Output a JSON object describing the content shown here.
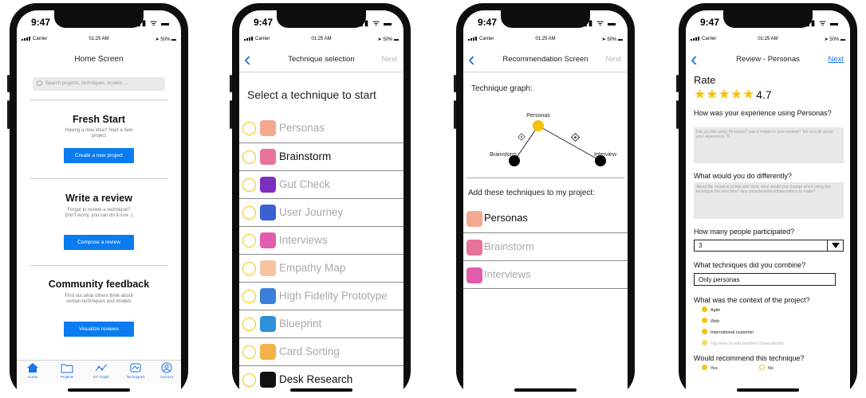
{
  "status_bar": {
    "time": "9:47",
    "carrier": "Carrier",
    "clock": "01:25 AM",
    "battery": "50%"
  },
  "accent_color": "#0a7cf0",
  "highlight_color": "#f4c20d",
  "home": {
    "title": "Home Screen",
    "search_placeholder": "Search projects, techniques, models ...",
    "fresh_start": {
      "title": "Fresh Start",
      "subtitle": "Having a new idea? Start a new project",
      "button": "Create a new project"
    },
    "write_review": {
      "title": "Write a review",
      "subtitle": "Forgot to review a technique? Don't worry, you can do it now :)",
      "button": "Compose a review"
    },
    "community": {
      "title": "Community feedback",
      "subtitle": "Find out what others think about certain techniques and models",
      "button": "Visualize reviews"
    },
    "tabs": [
      {
        "label": "Home",
        "icon": "home-icon"
      },
      {
        "label": "Projects",
        "icon": "folder-icon"
      },
      {
        "label": "DT Graph",
        "icon": "graph-icon"
      },
      {
        "label": "Techniques",
        "icon": "techniques-icon"
      },
      {
        "label": "Account",
        "icon": "account-icon"
      }
    ]
  },
  "technique_selection": {
    "title": "Technique selection",
    "next": "Next",
    "heading": "Select a technique to start",
    "techniques": [
      {
        "label": "Personas",
        "icon": "persona-icon",
        "color": "#f3a98f",
        "dark": false
      },
      {
        "label": "Brainstorm",
        "icon": "brain-icon",
        "color": "#e8739a",
        "dark": true
      },
      {
        "label": "Gut Check",
        "icon": "gut-check-icon",
        "color": "#7a2fbf",
        "dark": false
      },
      {
        "label": "User Journey",
        "icon": "journey-icon",
        "color": "#3a5fcf",
        "dark": false
      },
      {
        "label": "Interviews",
        "icon": "interview-icon",
        "color": "#e05dab",
        "dark": false
      },
      {
        "label": "Empathy Map",
        "icon": "empathy-icon",
        "color": "#f6c2a0",
        "dark": false
      },
      {
        "label": "High Fidelity Prototype",
        "icon": "prototype-icon",
        "color": "#3b7fd9",
        "dark": false
      },
      {
        "label": "Blueprint",
        "icon": "blueprint-icon",
        "color": "#2f8fd8",
        "dark": false
      },
      {
        "label": "Card Sorting",
        "icon": "cards-icon",
        "color": "#f2b24a",
        "dark": false
      },
      {
        "label": "Desk Research",
        "icon": "magnifier-icon",
        "color": "#111111",
        "dark": true
      }
    ]
  },
  "recommendation": {
    "title": "Recommendation Screen",
    "next": "Next",
    "graph_label": "Technique graph:",
    "graph_nodes": [
      "Personas",
      "Brainstorm",
      "Interview"
    ],
    "add_label": "Add these techniques to my project:",
    "items": [
      {
        "label": "Personas",
        "icon": "persona-icon",
        "color": "#f3a98f",
        "dark": true
      },
      {
        "label": "Brainstorm",
        "icon": "brain-icon",
        "color": "#e8739a",
        "dark": false
      },
      {
        "label": "Interviews",
        "icon": "interview-icon",
        "color": "#e05dab",
        "dark": false
      }
    ]
  },
  "review": {
    "title": "Review - Personas",
    "next": "Next",
    "rate_label": "Rate",
    "stars": "★★★★★",
    "rating": 4.7,
    "rating_text": "4.7",
    "q_experience": "How was your experience using Personas?",
    "a_experience_placeholder": "Did you like using Personas? was it helpful in your context? Tell us a bit about your experience :D",
    "q_differently": "What would you do differently?",
    "a_differently_placeholder": "About the negative points and cons, what would you change when using this technique the next time? Any considerations/observations to make?",
    "q_people": "How many people participated?",
    "people_value": "3",
    "q_combine": "What techniques did you combine?",
    "combine_value": "Only personas",
    "q_context": "What was the context of the project?",
    "contexts": [
      "Agile",
      "Web",
      "International customer"
    ],
    "context_add": "Tap here to add another characteristic",
    "q_recommend": "Would recommend this technique?",
    "yes": "Yes",
    "no": "No"
  }
}
